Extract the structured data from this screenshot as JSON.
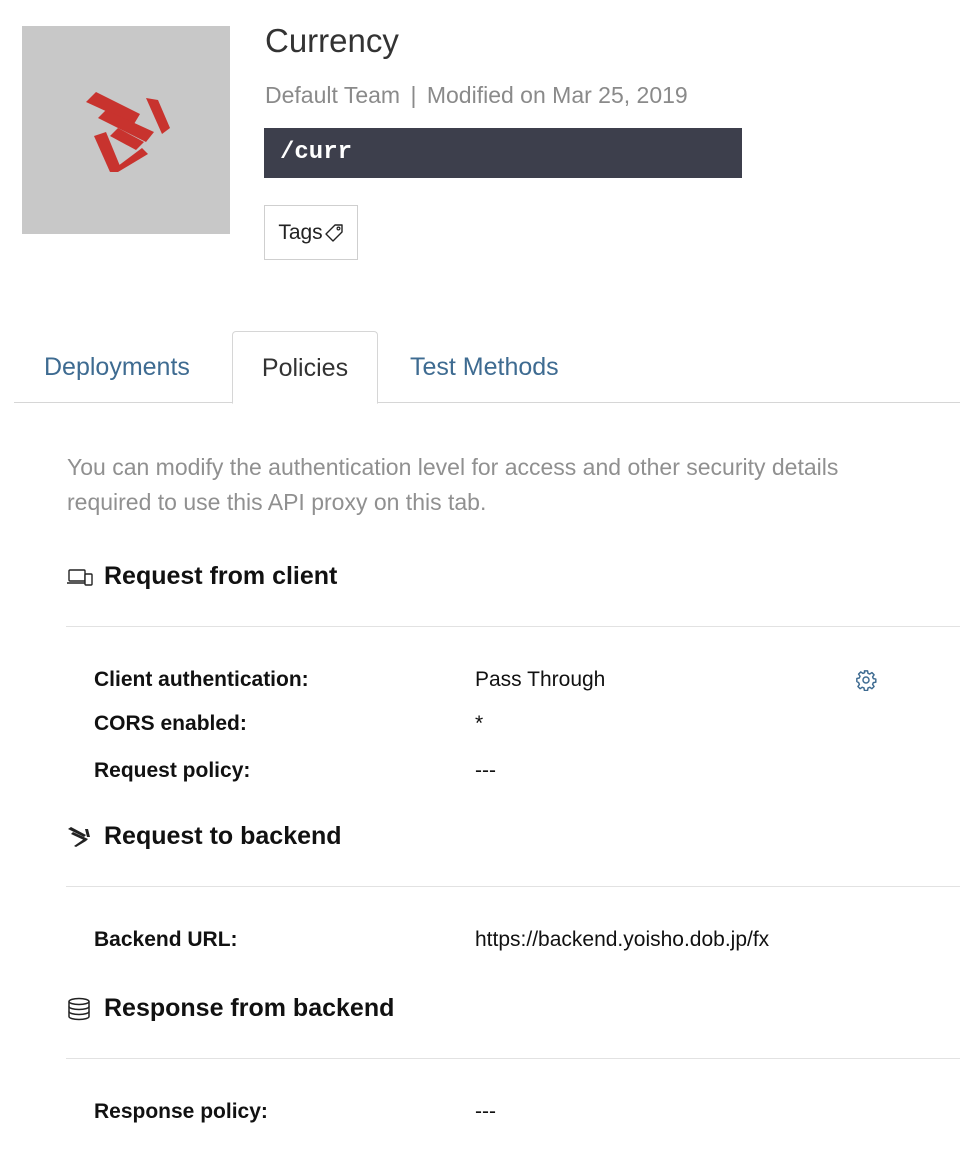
{
  "header": {
    "title": "Currency",
    "team": "Default Team",
    "separator": "|",
    "modified": "Modified on Mar 25, 2019",
    "path": "/curr",
    "tags_label": "Tags",
    "logo_color": "#c8332e"
  },
  "tabs": [
    {
      "label": "Deployments",
      "active": false
    },
    {
      "label": "Policies",
      "active": true
    },
    {
      "label": "Test Methods",
      "active": false
    }
  ],
  "description": "You can modify the authentication level for access and other security details required to use this API proxy on this tab.",
  "sections": {
    "request_from_client": {
      "title": "Request from client",
      "icon": "devices-icon",
      "rows": [
        {
          "label": "Client authentication:",
          "value": "Pass Through"
        },
        {
          "label": "CORS enabled:",
          "value": "*"
        },
        {
          "label": "Request policy:",
          "value": "---"
        }
      ]
    },
    "request_to_backend": {
      "title": "Request to backend",
      "icon": "send-icon",
      "rows": [
        {
          "label": "Backend URL:",
          "value": "https://backend.yoisho.dob.jp/fx"
        }
      ]
    },
    "response_from_backend": {
      "title": "Response from backend",
      "icon": "database-icon",
      "rows": [
        {
          "label": "Response policy:",
          "value": "---"
        }
      ]
    }
  },
  "colors": {
    "link": "#3e6b91",
    "path_bar": "#3d3f4c",
    "muted_text": "#909090"
  }
}
